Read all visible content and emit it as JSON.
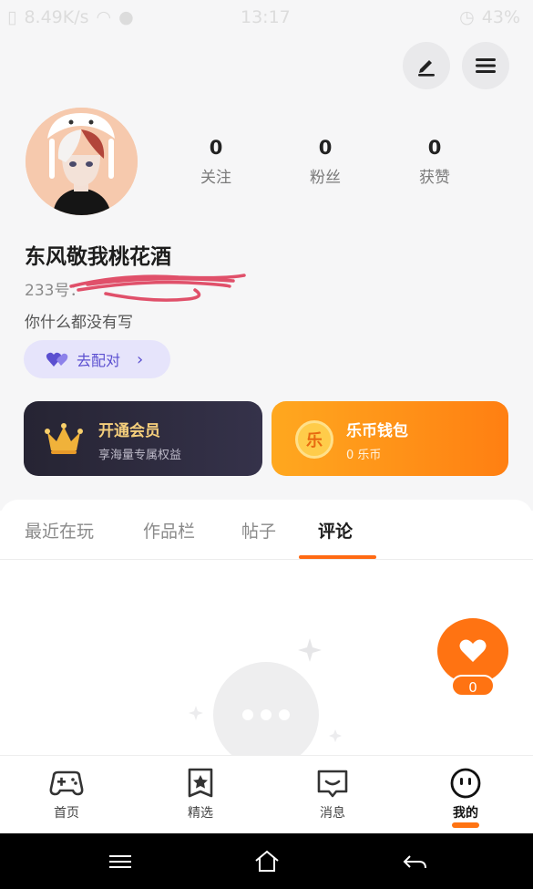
{
  "status_bar": {
    "speed": "8.49K/s",
    "time": "13:17",
    "battery": "43%"
  },
  "header": {
    "edit_icon": "pencil-icon",
    "menu_icon": "menu-icon"
  },
  "profile": {
    "stats": [
      {
        "value": "0",
        "label": "关注"
      },
      {
        "value": "0",
        "label": "粉丝"
      },
      {
        "value": "0",
        "label": "获赞"
      }
    ],
    "username": "东风敬我桃花酒",
    "id_prefix": "233号：",
    "bio": "你什么都没有写",
    "match_label": "去配对"
  },
  "cards": {
    "vip": {
      "title": "开通会员",
      "subtitle": "享海量专属权益"
    },
    "coin": {
      "title": "乐币钱包",
      "subtitle": "0 乐币",
      "coin_glyph": "乐"
    }
  },
  "tabs": [
    "最近在玩",
    "作品栏",
    "帖子",
    "评论"
  ],
  "active_tab": "评论",
  "fab": {
    "count": "0"
  },
  "bottom_nav": [
    {
      "label": "首页",
      "icon": "gamepad-icon"
    },
    {
      "label": "精选",
      "icon": "star-bookmark-icon"
    },
    {
      "label": "消息",
      "icon": "message-icon"
    },
    {
      "label": "我的",
      "icon": "face-icon"
    }
  ],
  "colors": {
    "accent": "#ff7312",
    "match_purple": "#5b4fd0",
    "vip_gold": "#f5cf7c"
  }
}
